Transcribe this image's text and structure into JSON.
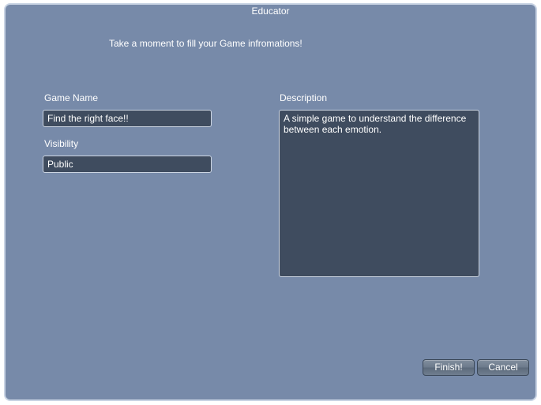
{
  "window": {
    "title": "Educator",
    "subtitle": "Take a moment to fill your Game infromations!"
  },
  "labels": {
    "gameName": "Game Name",
    "visibility": "Visibility",
    "description": "Description"
  },
  "fields": {
    "gameName": "Find the right face!!",
    "visibility": "Public",
    "description": "A simple game to understand the difference between each emotion."
  },
  "buttons": {
    "finish": "Finish!",
    "cancel": "Cancel"
  }
}
